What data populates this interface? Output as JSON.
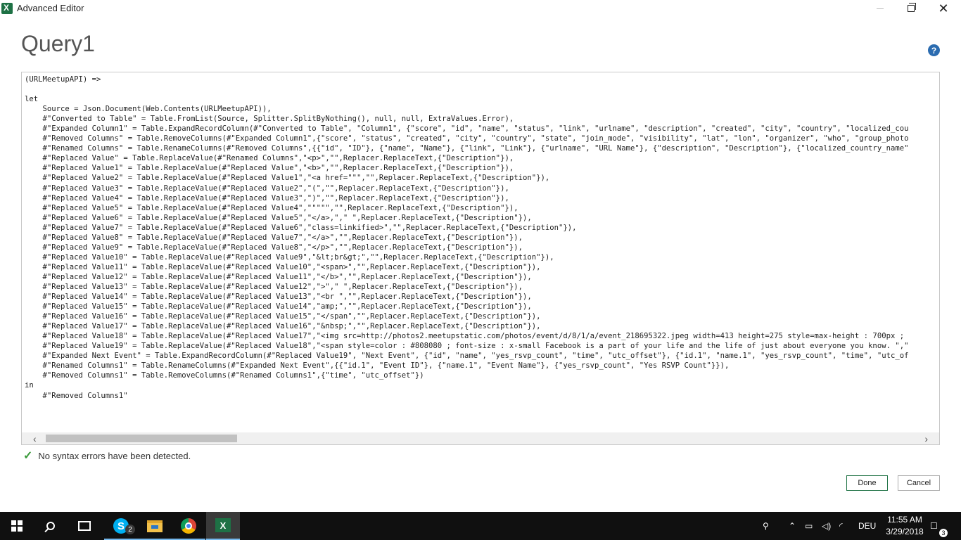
{
  "window": {
    "title": "Advanced Editor"
  },
  "query": {
    "name": "Query1"
  },
  "help": {
    "icon": "question-icon",
    "glyph": "?"
  },
  "code_lines": [
    "(URLMeetupAPI) =>",
    "",
    "let",
    "    Source = Json.Document(Web.Contents(URLMeetupAPI)),",
    "    #\"Converted to Table\" = Table.FromList(Source, Splitter.SplitByNothing(), null, null, ExtraValues.Error),",
    "    #\"Expanded Column1\" = Table.ExpandRecordColumn(#\"Converted to Table\", \"Column1\", {\"score\", \"id\", \"name\", \"status\", \"link\", \"urlname\", \"description\", \"created\", \"city\", \"country\", \"localized_cou",
    "    #\"Removed Columns\" = Table.RemoveColumns(#\"Expanded Column1\",{\"score\", \"status\", \"created\", \"city\", \"country\", \"state\", \"join_mode\", \"visibility\", \"lat\", \"lon\", \"organizer\", \"who\", \"group_photo",
    "    #\"Renamed Columns\" = Table.RenameColumns(#\"Removed Columns\",{{\"id\", \"ID\"}, {\"name\", \"Name\"}, {\"link\", \"Link\"}, {\"urlname\", \"URL Name\"}, {\"description\", \"Description\"}, {\"localized_country_name\"",
    "    #\"Replaced Value\" = Table.ReplaceValue(#\"Renamed Columns\",\"<p>\",\"\",Replacer.ReplaceText,{\"Description\"}),",
    "    #\"Replaced Value1\" = Table.ReplaceValue(#\"Replaced Value\",\"<b>\",\"\",Replacer.ReplaceText,{\"Description\"}),",
    "    #\"Replaced Value2\" = Table.ReplaceValue(#\"Replaced Value1\",\"<a href=\"\"\",\"\",Replacer.ReplaceText,{\"Description\"}),",
    "    #\"Replaced Value3\" = Table.ReplaceValue(#\"Replaced Value2\",\"(\",\"\",Replacer.ReplaceText,{\"Description\"}),",
    "    #\"Replaced Value4\" = Table.ReplaceValue(#\"Replaced Value3\",\")\",\"\",Replacer.ReplaceText,{\"Description\"}),",
    "    #\"Replaced Value5\" = Table.ReplaceValue(#\"Replaced Value4\",\"\"\"\"\",\"\",Replacer.ReplaceText,{\"Description\"}),",
    "    #\"Replaced Value6\" = Table.ReplaceValue(#\"Replaced Value5\",\"</a>,\",\" \",Replacer.ReplaceText,{\"Description\"}),",
    "    #\"Replaced Value7\" = Table.ReplaceValue(#\"Replaced Value6\",\"class=linkified>\",\"\",Replacer.ReplaceText,{\"Description\"}),",
    "    #\"Replaced Value8\" = Table.ReplaceValue(#\"Replaced Value7\",\"</a>\",\"\",Replacer.ReplaceText,{\"Description\"}),",
    "    #\"Replaced Value9\" = Table.ReplaceValue(#\"Replaced Value8\",\"</p>\",\"\",Replacer.ReplaceText,{\"Description\"}),",
    "    #\"Replaced Value10\" = Table.ReplaceValue(#\"Replaced Value9\",\"&lt;br&gt;\",\"\",Replacer.ReplaceText,{\"Description\"}),",
    "    #\"Replaced Value11\" = Table.ReplaceValue(#\"Replaced Value10\",\"<span>\",\"\",Replacer.ReplaceText,{\"Description\"}),",
    "    #\"Replaced Value12\" = Table.ReplaceValue(#\"Replaced Value11\",\"</b>\",\"\",Replacer.ReplaceText,{\"Description\"}),",
    "    #\"Replaced Value13\" = Table.ReplaceValue(#\"Replaced Value12\",\">\",\" \",Replacer.ReplaceText,{\"Description\"}),",
    "    #\"Replaced Value14\" = Table.ReplaceValue(#\"Replaced Value13\",\"<br \",\"\",Replacer.ReplaceText,{\"Description\"}),",
    "    #\"Replaced Value15\" = Table.ReplaceValue(#\"Replaced Value14\",\"amp;\",\"\",Replacer.ReplaceText,{\"Description\"}),",
    "    #\"Replaced Value16\" = Table.ReplaceValue(#\"Replaced Value15\",\"</span\",\"\",Replacer.ReplaceText,{\"Description\"}),",
    "    #\"Replaced Value17\" = Table.ReplaceValue(#\"Replaced Value16\",\"&nbsp;\",\"\",Replacer.ReplaceText,{\"Description\"}),",
    "    #\"Replaced Value18\" = Table.ReplaceValue(#\"Replaced Value17\",\"<img src=http://photos2.meetupstatic.com/photos/event/d/8/1/a/event_218695322.jpeg width=413 height=275 style=max-height : 700px ;",
    "    #\"Replaced Value19\" = Table.ReplaceValue(#\"Replaced Value18\",\"<span style=color : #808080 ; font-size : x-small Facebook is a part of your life and the life of just about everyone you know. \",\"",
    "    #\"Expanded Next Event\" = Table.ExpandRecordColumn(#\"Replaced Value19\", \"Next Event\", {\"id\", \"name\", \"yes_rsvp_count\", \"time\", \"utc_offset\"}, {\"id.1\", \"name.1\", \"yes_rsvp_count\", \"time\", \"utc_of",
    "    #\"Renamed Columns1\" = Table.RenameColumns(#\"Expanded Next Event\",{{\"id.1\", \"Event ID\"}, {\"name.1\", \"Event Name\"}, {\"yes_rsvp_count\", \"Yes RSVP Count\"}}),",
    "    #\"Removed Columns1\" = Table.RemoveColumns(#\"Renamed Columns1\",{\"time\", \"utc_offset\"})",
    "in",
    "    #\"Removed Columns1\""
  ],
  "status": {
    "icon": "check-icon",
    "text": "No syntax errors have been detected."
  },
  "buttons": {
    "done": "Done",
    "cancel": "Cancel"
  },
  "taskbar": {
    "skype_badge": "2",
    "language": "DEU",
    "time": "11:55 AM",
    "date": "3/29/2018",
    "notifications": "3"
  }
}
